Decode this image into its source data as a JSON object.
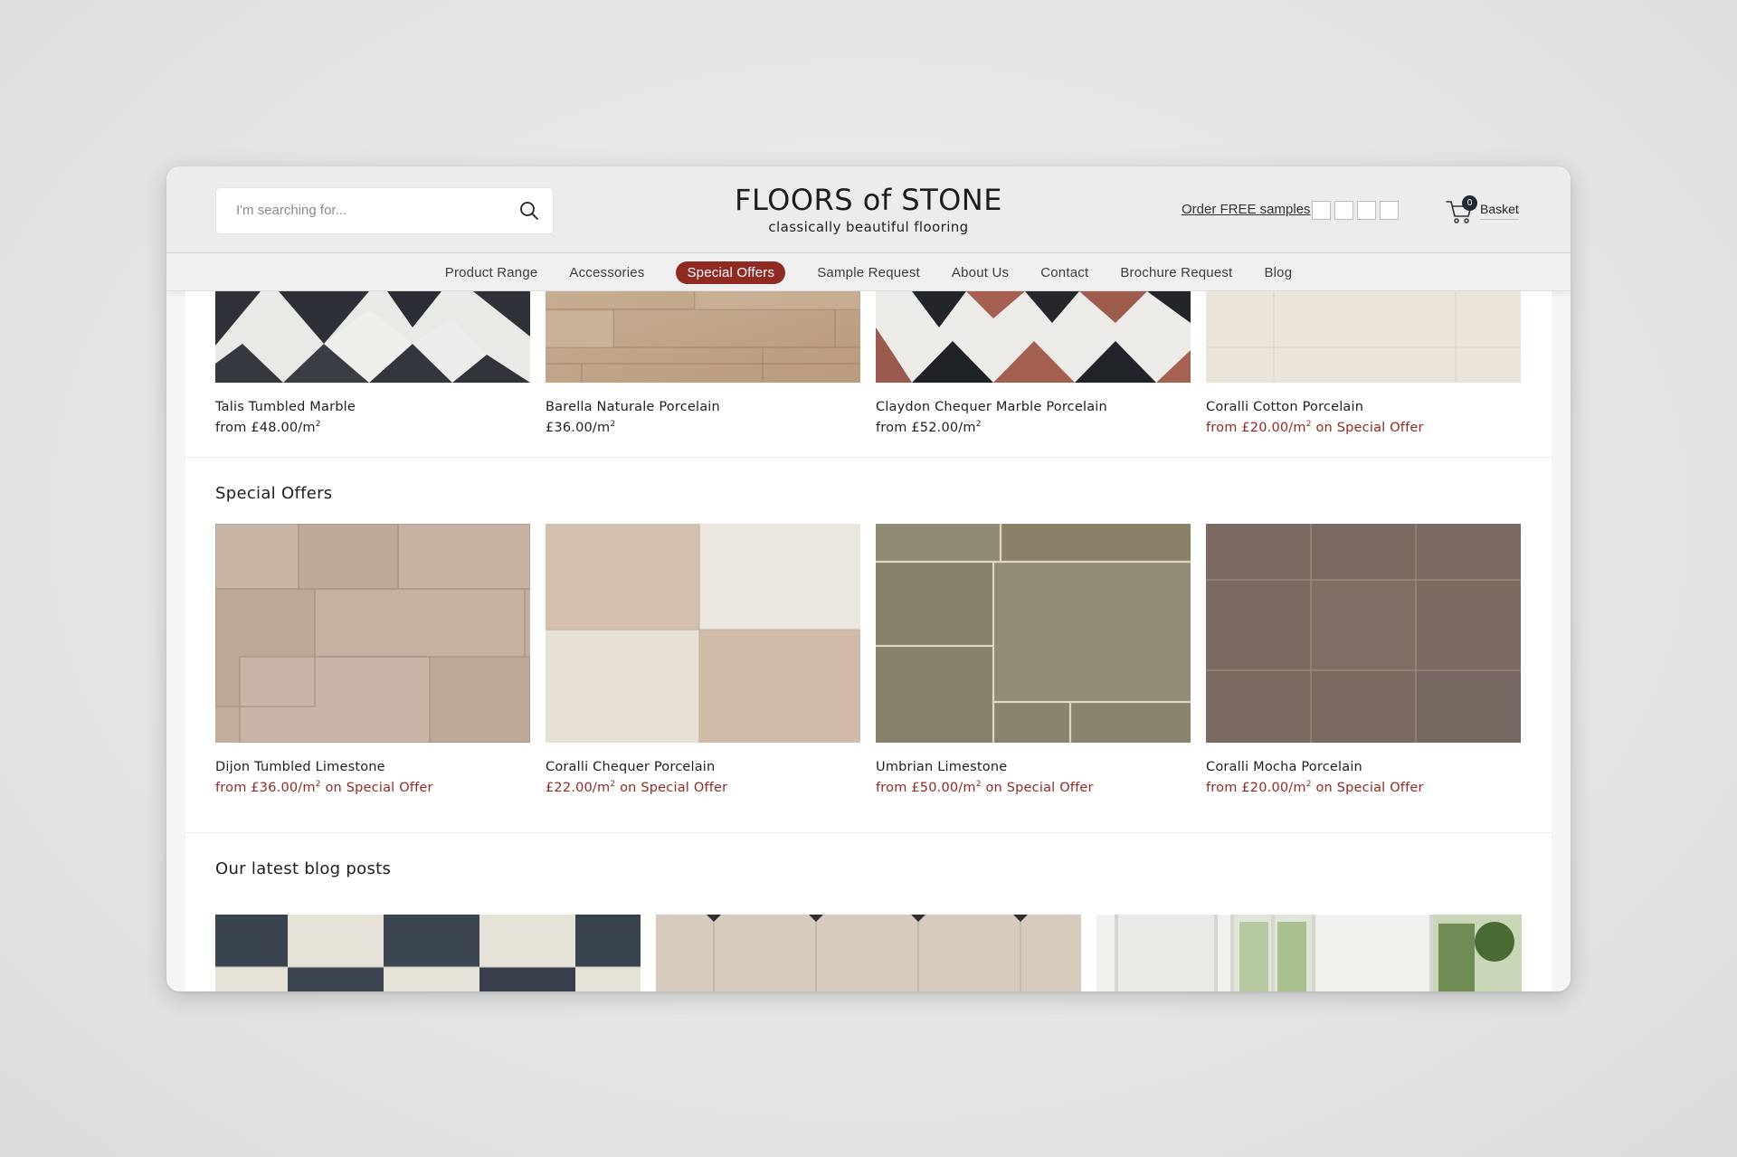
{
  "header": {
    "search_placeholder": "I'm searching for...",
    "logo_title": "FLOORS of STONE",
    "logo_tagline": "classically beautiful flooring",
    "samples_link": "Order FREE samples",
    "basket_label": "Basket",
    "basket_count": "0"
  },
  "nav": {
    "items": [
      "Product Range",
      "Accessories",
      "Special Offers",
      "Sample Request",
      "About Us",
      "Contact",
      "Brochure Request",
      "Blog"
    ],
    "active_item": "Special Offers"
  },
  "top_products": [
    {
      "name": "Talis Tumbled Marble",
      "price_prefix": "from ",
      "price": "£48.00/m",
      "unit_sup": "2",
      "offer": ""
    },
    {
      "name": "Barella Naturale Porcelain",
      "price_prefix": "",
      "price": "£36.00/m",
      "unit_sup": "2",
      "offer": ""
    },
    {
      "name": "Claydon Chequer Marble Porcelain",
      "price_prefix": "from ",
      "price": "£52.00/m",
      "unit_sup": "2",
      "offer": ""
    },
    {
      "name": "Coralli Cotton Porcelain",
      "price_prefix": "from ",
      "price": "£20.00/m",
      "unit_sup": "2",
      "offer": " on Special Offer"
    }
  ],
  "special_offers": {
    "title": "Special Offers",
    "products": [
      {
        "name": "Dijon Tumbled Limestone",
        "price_prefix": "from ",
        "price": "£36.00/m",
        "unit_sup": "2",
        "offer": " on Special Offer"
      },
      {
        "name": "Coralli Chequer Porcelain",
        "price_prefix": "",
        "price": "£22.00/m",
        "unit_sup": "2",
        "offer": " on Special Offer"
      },
      {
        "name": "Umbrian Limestone",
        "price_prefix": "from ",
        "price": "£50.00/m",
        "unit_sup": "2",
        "offer": " on Special Offer"
      },
      {
        "name": "Coralli Mocha Porcelain",
        "price_prefix": "from ",
        "price": "£20.00/m",
        "unit_sup": "2",
        "offer": " on Special Offer"
      }
    ]
  },
  "blog": {
    "title": "Our latest blog posts"
  },
  "colors": {
    "accent": "#8e2a22",
    "badge": "#1f2a36",
    "text": "#1e1e1e"
  }
}
